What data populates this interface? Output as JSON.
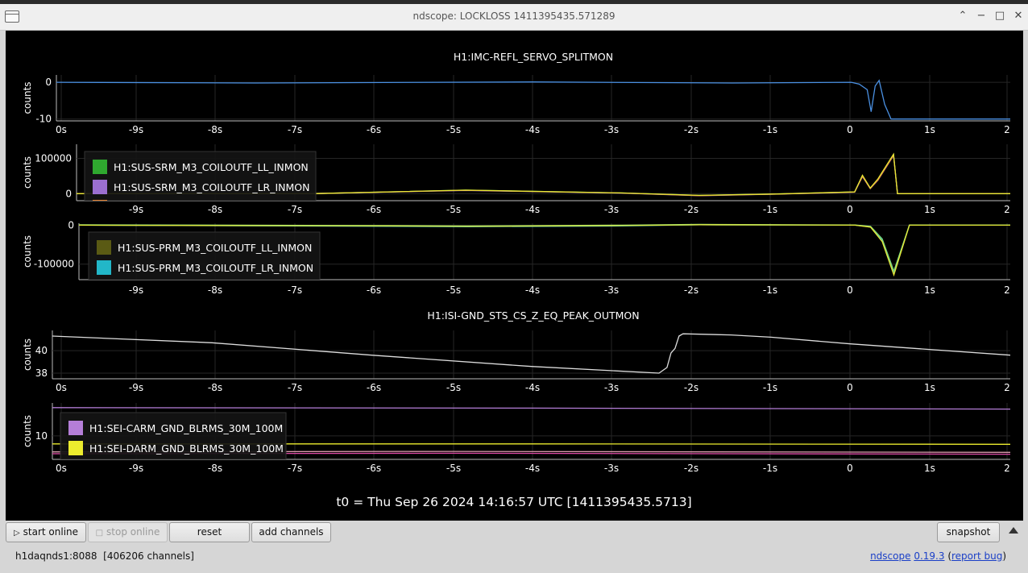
{
  "window": {
    "title": "ndscope: LOCKLOSS 1411395435.571289"
  },
  "colors": {
    "background": "#000000",
    "grid": "#262626",
    "axis": "#bbbbbb",
    "text": "#ffffff"
  },
  "chart_data": [
    {
      "type": "line",
      "title": "H1:IMC-REFL_SERVO_SPLITMON",
      "ylabel": "counts",
      "yticks": [
        "0",
        "-10"
      ],
      "xticks": [
        "0s",
        "-9s",
        "-8s",
        "-7s",
        "-6s",
        "-5s",
        "-4s",
        "-3s",
        "-2s",
        "-1s",
        "0",
        "1s",
        "2"
      ],
      "xlim": [
        -10,
        2
      ],
      "ylim": [
        -10.5,
        2
      ],
      "series": [
        {
          "color": "#4a90e2",
          "x": [
            -10,
            -7.5,
            -4,
            -1.5,
            0,
            0.1,
            0.2,
            0.25,
            0.3,
            0.35,
            0.42,
            0.5,
            2
          ],
          "y": [
            0,
            -0.2,
            0.1,
            -0.2,
            0,
            -0.5,
            -2,
            -8,
            -1,
            0.5,
            -6,
            -10,
            -10
          ]
        }
      ]
    },
    {
      "type": "line",
      "ylabel": "counts",
      "yticks": [
        "100000",
        "0"
      ],
      "xticks": [
        "-9s",
        "-8s",
        "-7s",
        "-6s",
        "-5s",
        "-4s",
        "-3s",
        "-2s",
        "-1s",
        "0",
        "1s",
        "2"
      ],
      "xlim": [
        -10,
        2
      ],
      "ylim": [
        -20000,
        140000
      ],
      "legend": [
        "H1:SUS-SRM_M3_COILOUTF_LL_INMON",
        "H1:SUS-SRM_M3_COILOUTF_LR_INMON"
      ],
      "legend_colors": [
        "#2fa82f",
        "#9b6fd0",
        "#e07b2a"
      ],
      "series": [
        {
          "name": "H1:SUS-SRM_M3_COILOUTF_LL_INMON",
          "color": "#2fa82f",
          "x": [
            -10,
            -7,
            -5,
            -3,
            -2,
            -1,
            0,
            0.1,
            0.2,
            0.3,
            0.5,
            0.55,
            2
          ],
          "y": [
            0,
            0,
            10000,
            2000,
            -5000,
            -1000,
            5000,
            50000,
            15000,
            40000,
            110000,
            0,
            0
          ]
        },
        {
          "name": "H1:SUS-SRM_M3_COILOUTF_LR_INMON",
          "color": "#9b6fd0",
          "x": [
            -10,
            -7,
            -5,
            -3,
            -2,
            -1,
            0,
            0.1,
            0.2,
            0.3,
            0.5,
            0.55,
            2
          ],
          "y": [
            0,
            0,
            9000,
            1500,
            -6000,
            -1500,
            4000,
            48000,
            14000,
            38000,
            108000,
            0,
            0
          ]
        },
        {
          "color": "#e07b2a",
          "x": [
            -10,
            -7,
            -5,
            -3,
            -2,
            -1,
            0,
            0.1,
            0.2,
            0.3,
            0.5,
            0.55,
            2
          ],
          "y": [
            0,
            0,
            9500,
            1800,
            -5500,
            -1200,
            4500,
            49000,
            14500,
            39000,
            109000,
            0,
            0
          ]
        },
        {
          "color": "#e8e836",
          "x": [
            -10,
            -7,
            -5,
            -3,
            -2,
            -1,
            0,
            0.1,
            0.2,
            0.3,
            0.5,
            0.55,
            2
          ],
          "y": [
            0,
            0,
            10000,
            2000,
            -5000,
            -1000,
            5000,
            52000,
            16000,
            42000,
            112000,
            0,
            0
          ]
        }
      ]
    },
    {
      "type": "line",
      "ylabel": "counts",
      "yticks": [
        "0",
        "-100000"
      ],
      "xticks": [
        "-9s",
        "-8s",
        "-7s",
        "-6s",
        "-5s",
        "-4s",
        "-3s",
        "-2s",
        "-1s",
        "0",
        "1s",
        "2"
      ],
      "xlim": [
        -10,
        2
      ],
      "ylim": [
        -140000,
        5000
      ],
      "legend": [
        "H1:SUS-PRM_M3_COILOUTF_LL_INMON",
        "H1:SUS-PRM_M3_COILOUTF_LR_INMON"
      ],
      "legend_colors": [
        "#5a5a14",
        "#22b7c8",
        "#d8f0f0"
      ],
      "series": [
        {
          "name": "H1:SUS-PRM_M3_COILOUTF_LL_INMON",
          "color": "#5a5a14",
          "x": [
            -10,
            -6,
            -5,
            -3,
            -2,
            0,
            0.2,
            0.35,
            0.5,
            0.7,
            2
          ],
          "y": [
            0,
            -2000,
            -3000,
            -1000,
            1000,
            0,
            -5000,
            -40000,
            -125000,
            0,
            0
          ]
        },
        {
          "name": "H1:SUS-PRM_M3_COILOUTF_LR_INMON",
          "color": "#22b7c8",
          "x": [
            -10,
            -6,
            -5,
            -3,
            -2,
            0,
            0.2,
            0.35,
            0.5,
            0.7,
            2
          ],
          "y": [
            0,
            -3000,
            -4000,
            -2000,
            1000,
            0,
            -4000,
            -38000,
            -120000,
            0,
            0
          ]
        },
        {
          "color": "#7bd67b",
          "x": [
            -10,
            -6,
            -5,
            -3,
            -2,
            0,
            0.2,
            0.35,
            0.5,
            0.7,
            2
          ],
          "y": [
            1000,
            -1000,
            -2000,
            0,
            2000,
            500,
            -3000,
            -35000,
            -118000,
            500,
            0
          ]
        },
        {
          "color": "#e8e836",
          "x": [
            -10,
            -6,
            -5,
            -3,
            -2,
            0,
            0.2,
            0.35,
            0.5,
            0.7,
            2
          ],
          "y": [
            0,
            -2000,
            -3000,
            -1000,
            1000,
            0,
            -5000,
            -42000,
            -128000,
            0,
            0
          ]
        }
      ]
    },
    {
      "type": "line",
      "title": "H1:ISI-GND_STS_CS_Z_EQ_PEAK_OUTMON",
      "ylabel": "counts",
      "yticks": [
        "40",
        "38"
      ],
      "xticks": [
        "0s",
        "-9s",
        "-8s",
        "-7s",
        "-6s",
        "-5s",
        "-4s",
        "-3s",
        "-2s",
        "-1s",
        "0",
        "1s",
        "2"
      ],
      "xlim": [
        -10,
        2
      ],
      "ylim": [
        37.5,
        41.8
      ],
      "series": [
        {
          "color": "#dddddd",
          "x": [
            -10,
            -8,
            -6,
            -4,
            -2.4,
            -2.3,
            -2.25,
            -2.2,
            -2.15,
            -2.1,
            -1.5,
            -1,
            0,
            2
          ],
          "y": [
            41.3,
            40.7,
            39.6,
            38.6,
            38,
            38.5,
            39.8,
            40.2,
            41.3,
            41.5,
            41.4,
            41.2,
            40.6,
            39.6
          ]
        }
      ]
    },
    {
      "type": "line",
      "ylabel": "counts",
      "yticks": [
        "10"
      ],
      "xticks": [
        "0s",
        "-9s",
        "-8s",
        "-7s",
        "-6s",
        "-5s",
        "-4s",
        "-3s",
        "-2s",
        "-1s",
        "0",
        "1s",
        "2"
      ],
      "xlim": [
        -10,
        2
      ],
      "ylim": [
        5,
        17
      ],
      "legend": [
        "H1:SEI-CARM_GND_BLRMS_30M_100M",
        "H1:SEI-DARM_GND_BLRMS_30M_100M"
      ],
      "legend_colors": [
        "#b57ed8",
        "#ecec2e",
        "#d89aaa"
      ],
      "series": [
        {
          "name": "H1:SEI-CARM_GND_BLRMS_30M_100M",
          "color": "#b57ed8",
          "x": [
            -10,
            -4,
            2
          ],
          "y": [
            16,
            15.9,
            15.7
          ]
        },
        {
          "name": "H1:SEI-DARM_GND_BLRMS_30M_100M",
          "color": "#ecec2e",
          "x": [
            -10,
            -4,
            2
          ],
          "y": [
            8.3,
            8.3,
            8.2
          ]
        },
        {
          "color": "#d89aaa",
          "x": [
            -10,
            -5,
            2
          ],
          "y": [
            6.6,
            6.7,
            6.5
          ]
        },
        {
          "color": "#e04aa8",
          "x": [
            -10,
            -5,
            2
          ],
          "y": [
            6.2,
            6.3,
            6.1
          ]
        }
      ]
    }
  ],
  "footer": {
    "t0": "t0 = Thu Sep 26 2024 14:16:57 UTC [1411395435.5713]"
  },
  "buttons": {
    "start_online": "start online",
    "stop_online": "stop online",
    "reset": "reset",
    "add_channels": "add channels",
    "snapshot": "snapshot"
  },
  "status": {
    "server": "h1daqnds1:8088",
    "channels": "[406206 channels]",
    "app_name": "ndscope",
    "version": "0.19.3",
    "report": "report bug",
    "open_paren": "(",
    "close_paren": ")"
  }
}
